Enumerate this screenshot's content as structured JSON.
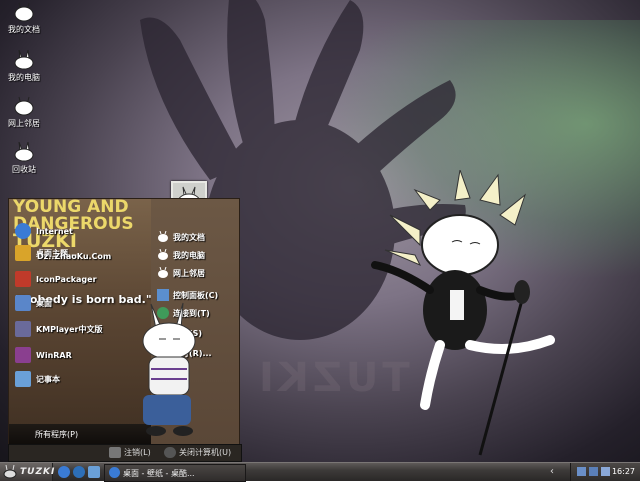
{
  "desktop": {
    "icons": [
      {
        "label": "我的文档",
        "icon": "tuzki-head-icon"
      },
      {
        "label": "我的电脑",
        "icon": "tuzki-rabbit-icon"
      },
      {
        "label": "网上邻居",
        "icon": "tuzki-head-icon"
      },
      {
        "label": "回收站",
        "icon": "tuzki-rabbit-icon"
      }
    ],
    "watermark": "TUZKI"
  },
  "start_menu": {
    "poster_lines": [
      "YOUNG AND",
      "DANGEROUS",
      "TUZKI"
    ],
    "quote": "\"Nobody is born bad.\"",
    "programs": [
      {
        "label": "Internet",
        "icon": "internet-explorer-icon",
        "color": "#3a7bd5"
      },
      {
        "label": "桌面主题...",
        "icon": "theme-icon",
        "color": "#d9a42a"
      },
      {
        "label": "Dz..ZhaoKu.Com",
        "icon": "website-icon",
        "color": "#e6e6e6"
      },
      {
        "label": "IconPackager",
        "icon": "iconpackager-icon",
        "color": "#c03a2a"
      },
      {
        "label": "桌面",
        "icon": "desktop-icon",
        "color": "#5a86c9"
      },
      {
        "label": "KMPlayer中文版",
        "icon": "kmplayer-icon",
        "color": "#6a6a9a"
      },
      {
        "label": "WinRAR",
        "icon": "winrar-icon",
        "color": "#8a3f8f"
      },
      {
        "label": "记事本",
        "icon": "notepad-icon",
        "color": "#6aa0d8"
      }
    ],
    "all_programs": "所有程序(P)",
    "places": [
      {
        "label": "我的文档",
        "icon": "tuzki-small-icon"
      },
      {
        "label": "我的电脑",
        "icon": "tuzki-small-icon"
      },
      {
        "label": "网上邻居",
        "icon": "tuzki-small-icon"
      },
      {
        "label": "控制面板(C)",
        "icon": "control-panel-icon"
      },
      {
        "label": "连接到(T)",
        "icon": "connect-icon"
      },
      {
        "label": "搜索(S)",
        "icon": "search-icon"
      },
      {
        "label": "运行(R)...",
        "icon": "run-icon"
      }
    ],
    "logoff": "注销(L)",
    "shutdown": "关闭计算机(U)"
  },
  "taskbar": {
    "start_label": "TUZKI",
    "task_label": "桌面 - 壁纸 - 桌酷...",
    "clock": "16:27"
  },
  "colors": {
    "accent_yellow": "#ecd86a",
    "menu_brown": "#5b4633"
  }
}
